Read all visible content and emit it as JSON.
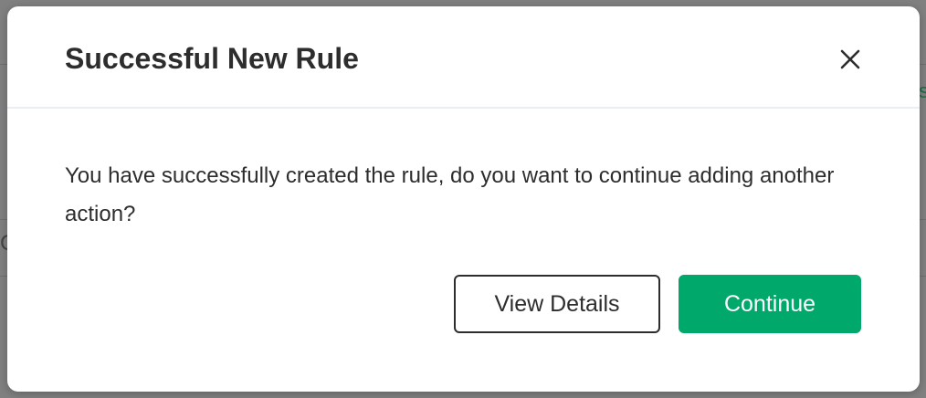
{
  "modal": {
    "title": "Successful New Rule",
    "message": "You have successfully created the rule, do you want to continue adding another action?",
    "close_icon": "close-icon",
    "buttons": {
      "view_details_label": "View Details",
      "continue_label": "Continue"
    }
  },
  "background": {
    "right_glyph": "s",
    "left_glyph": "C"
  },
  "colors": {
    "primary": "#00a86b",
    "text": "#2d2d2d",
    "overlay": "#808080",
    "divider": "#eceef5"
  }
}
